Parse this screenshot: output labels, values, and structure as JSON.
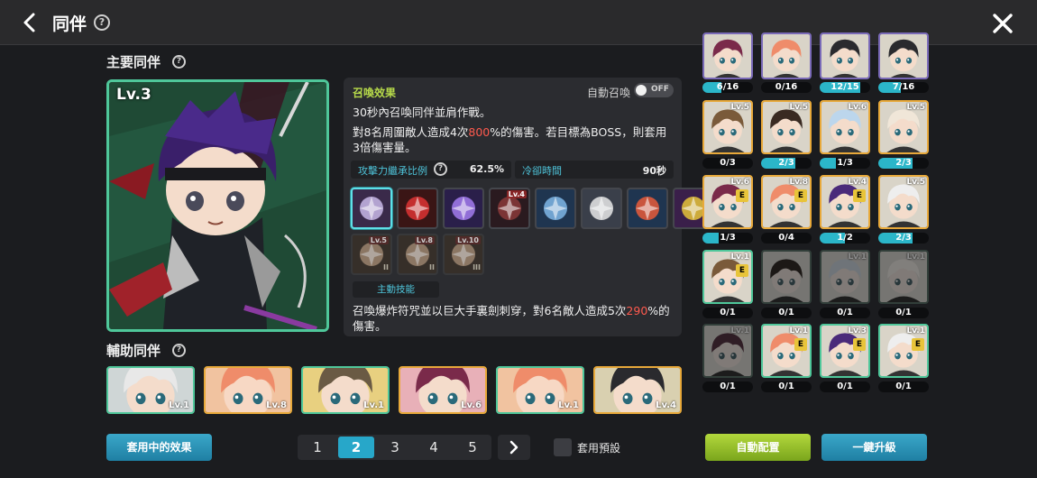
{
  "header": {
    "title": "同伴",
    "help": "?"
  },
  "main_section": {
    "title": "主要同伴",
    "help": "?"
  },
  "main_companion": {
    "level": "Lv.3"
  },
  "summon": {
    "heading": "召喚效果",
    "auto_label": "自動召喚",
    "toggle_state": "OFF",
    "line1": "30秒內召喚同伴並肩作戰。",
    "line2_a": "對8名周圍敵人造成4次",
    "line2_hl": "800",
    "line2_b": "%的傷害。若目標為BOSS，則套用3倍傷害量。",
    "stat1_label": "攻擊力繼承比例",
    "stat1_help": "?",
    "stat1_value": "62.5%",
    "stat2_label": "冷卻時間",
    "stat2_value": "90秒",
    "active_tag": "主動技能",
    "skill_a": "召喚爆炸符咒並以巨大手裏劍刺穿，對6名敵人造成5次",
    "skill_hl": "290",
    "skill_b": "%的傷害。"
  },
  "skills": [
    {
      "icon": "hidden-bomb-icon",
      "level": "",
      "roman": "",
      "selected": true,
      "bg": "#3a2a4a",
      "fg": "#c9b8e8"
    },
    {
      "icon": "red-burst-icon",
      "level": "",
      "roman": "",
      "selected": false,
      "bg": "#3a1515",
      "fg": "#d33"
    },
    {
      "icon": "purple-orb-icon",
      "level": "",
      "roman": "",
      "selected": false,
      "bg": "#2a1f4a",
      "fg": "#a37cf0"
    },
    {
      "icon": "dark-gear-icon",
      "level": "Lv.4",
      "roman": "",
      "selected": false,
      "bg": "#2a1a1f",
      "fg": "#8a3a3a"
    },
    {
      "icon": "blade-icon",
      "level": "",
      "roman": "",
      "selected": false,
      "bg": "#1f3550",
      "fg": "#7fb6e6"
    },
    {
      "icon": "fist-burst-icon",
      "level": "",
      "roman": "",
      "selected": false,
      "bg": "#3a3f4a",
      "fg": "#e8e8e8"
    },
    {
      "icon": "double-arrow-icon",
      "level": "",
      "roman": "",
      "selected": false,
      "bg": "#1f3550",
      "fg": "#e85a3a"
    },
    {
      "icon": "star-mark-icon",
      "level": "",
      "roman": "",
      "selected": false,
      "bg": "#3a1f4a",
      "fg": "#e8c43a"
    },
    {
      "icon": "scroll-icon",
      "level": "Lv.5",
      "roman": "II",
      "selected": false,
      "bg": "#4a3a2a",
      "fg": "#d9a06a"
    },
    {
      "icon": "scroll-icon",
      "level": "Lv.8",
      "roman": "II",
      "selected": false,
      "bg": "#4a3a2a",
      "fg": "#d9a06a"
    },
    {
      "icon": "scroll-icon",
      "level": "Lv.10",
      "roman": "III",
      "selected": false,
      "bg": "#4a3a2a",
      "fg": "#d9a06a"
    }
  ],
  "support_section": {
    "title": "輔助同伴",
    "help": "?"
  },
  "supports": [
    {
      "level": "Lv.1",
      "frame": "green",
      "hair": "#e8e8e8",
      "skin": "#f4dccb",
      "bg": "#cfd6d6"
    },
    {
      "level": "Lv.8",
      "frame": "gold",
      "hair": "#ef8c6a",
      "skin": "#f7d8c4",
      "bg": "#f1c3a0"
    },
    {
      "level": "Lv.1",
      "frame": "green",
      "hair": "#6a5a44",
      "skin": "#f4dccb",
      "bg": "#e8d080"
    },
    {
      "level": "Lv.6",
      "frame": "gold",
      "hair": "#7a2a4a",
      "skin": "#f4dccb",
      "bg": "#e8b0b8"
    },
    {
      "level": "Lv.1",
      "frame": "green",
      "hair": "#ef8c6a",
      "skin": "#f7d8c4",
      "bg": "#f1c3a0"
    },
    {
      "level": "Lv.4",
      "frame": "gold",
      "hair": "#2a2a2e",
      "skin": "#f4dccb",
      "bg": "#d9d0b0"
    }
  ],
  "buttons": {
    "effects": "套用中的效果",
    "preset": "套用預設",
    "auto_assign": "自動配置",
    "upgrade_all": "一鍵升級"
  },
  "pagination": {
    "pages": [
      "1",
      "2",
      "3",
      "4",
      "5"
    ],
    "current": "2"
  },
  "grid": [
    {
      "level": "",
      "e": false,
      "count": "6/16",
      "progress": 0.375,
      "frame": "purple",
      "hair": "#7a2a4a",
      "dim": false
    },
    {
      "level": "",
      "e": false,
      "count": "0/16",
      "progress": 0.0,
      "frame": "purple",
      "hair": "#ef8c6a",
      "dim": false
    },
    {
      "level": "",
      "e": false,
      "count": "12/15",
      "progress": 0.8,
      "frame": "purple",
      "hair": "#2a2a2e",
      "dim": false
    },
    {
      "level": "",
      "e": false,
      "count": "7/16",
      "progress": 0.4375,
      "frame": "purple",
      "hair": "#2a2a2e",
      "dim": false
    },
    {
      "level": "Lv.5",
      "e": false,
      "count": "0/3",
      "progress": 0.0,
      "frame": "gold",
      "hair": "#7a5a3a",
      "dim": false
    },
    {
      "level": "Lv.5",
      "e": false,
      "count": "2/3",
      "progress": 0.667,
      "frame": "gold",
      "hair": "#3a2a22",
      "dim": false
    },
    {
      "level": "Lv.6",
      "e": false,
      "count": "1/3",
      "progress": 0.333,
      "frame": "gold",
      "hair": "#bcd6ec",
      "dim": false
    },
    {
      "level": "Lv.5",
      "e": false,
      "count": "2/3",
      "progress": 0.667,
      "frame": "gold",
      "hair": "#f0e6d8",
      "dim": false
    },
    {
      "level": "Lv.6",
      "e": true,
      "count": "1/3",
      "progress": 0.333,
      "frame": "gold",
      "hair": "#7a2a4a",
      "dim": false
    },
    {
      "level": "Lv.8",
      "e": true,
      "count": "0/4",
      "progress": 0.0,
      "frame": "gold",
      "hair": "#ef8c6a",
      "dim": false
    },
    {
      "level": "Lv.4",
      "e": true,
      "count": "1/2",
      "progress": 0.5,
      "frame": "gold",
      "hair": "#4a2a7a",
      "dim": false
    },
    {
      "level": "Lv.5",
      "e": false,
      "count": "2/3",
      "progress": 0.667,
      "frame": "gold",
      "hair": "#eeeeee",
      "dim": false
    },
    {
      "level": "Lv.1",
      "e": true,
      "count": "0/1",
      "progress": 0.0,
      "frame": "green",
      "hair": "#7a5a3a",
      "dim": false
    },
    {
      "level": "",
      "e": false,
      "count": "0/1",
      "progress": 0.0,
      "frame": "green",
      "hair": "#3a2a22",
      "dim": true
    },
    {
      "level": "Lv.1",
      "e": false,
      "count": "0/1",
      "progress": 0.0,
      "frame": "green",
      "hair": "#bcd6ec",
      "dim": true
    },
    {
      "level": "Lv.1",
      "e": false,
      "count": "0/1",
      "progress": 0.0,
      "frame": "green",
      "hair": "#f0e6d8",
      "dim": true
    },
    {
      "level": "Lv.1",
      "e": false,
      "count": "0/1",
      "progress": 0.0,
      "frame": "green",
      "hair": "#7a2a4a",
      "dim": true
    },
    {
      "level": "Lv.1",
      "e": true,
      "count": "0/1",
      "progress": 0.0,
      "frame": "green",
      "hair": "#ef8c6a",
      "dim": false
    },
    {
      "level": "Lv.3",
      "e": true,
      "count": "0/1",
      "progress": 0.0,
      "frame": "green",
      "hair": "#4a2a7a",
      "dim": false
    },
    {
      "level": "Lv.1",
      "e": true,
      "count": "0/1",
      "progress": 0.0,
      "frame": "green",
      "hair": "#eeeeee",
      "dim": false
    }
  ]
}
